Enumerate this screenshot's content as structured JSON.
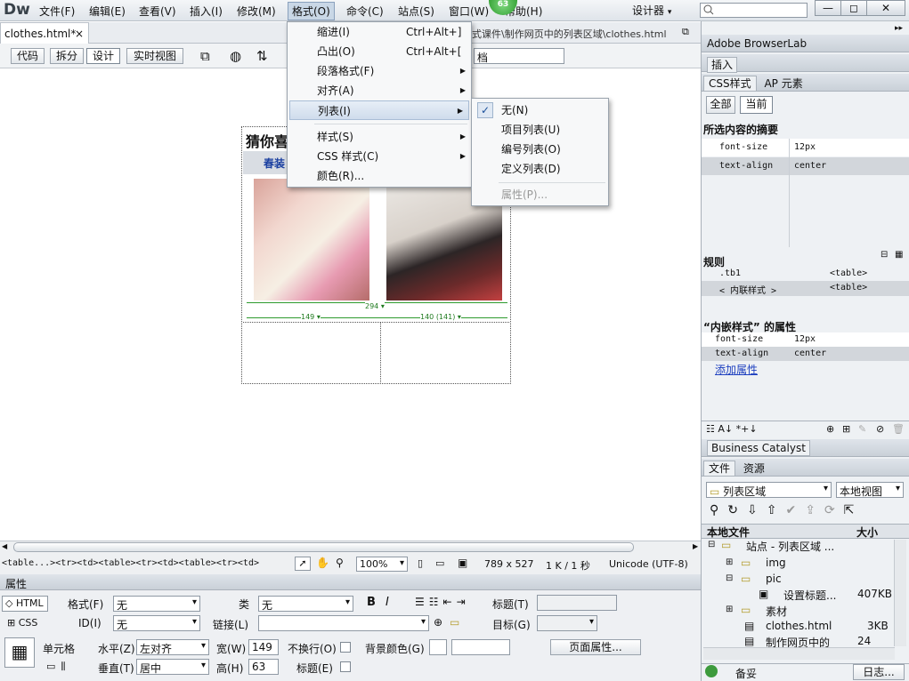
{
  "app": {
    "logo": "Dw",
    "workspace": "设计器"
  },
  "menubar": [
    "文件(F)",
    "编辑(E)",
    "查看(V)",
    "插入(I)",
    "修改(M)",
    "格式(O)",
    "命令(C)",
    "站点(S)",
    "窗口(W)",
    "帮助(H)"
  ],
  "badge": "63",
  "window_buttons": [
    "—",
    "◻",
    "✕"
  ],
  "doc": {
    "tab": "clothes.html*",
    "close": "×",
    "path": "式课件\\制作网页中的列表区域\\clothes.html"
  },
  "view_buttons": [
    "代码",
    "拆分",
    "设计",
    "实时视图"
  ],
  "title_partial": "档",
  "page": {
    "heading": "猜你喜",
    "link": "春装",
    "width_total": "294 ▾",
    "col1": "149 ▾",
    "col2": "140 (141) ▾"
  },
  "format_menu": [
    {
      "label": "缩进(I)",
      "shortcut": "Ctrl+Alt+]"
    },
    {
      "label": "凸出(O)",
      "shortcut": "Ctrl+Alt+["
    },
    {
      "label": "段落格式(F)"
    },
    {
      "label": "对齐(A)"
    },
    {
      "label": "列表(I)"
    },
    {
      "label": "样式(S)"
    },
    {
      "label": "CSS 样式(C)"
    },
    {
      "label": "颜色(R)..."
    }
  ],
  "list_submenu": [
    "无(N)",
    "项目列表(U)",
    "编号列表(O)",
    "定义列表(D)",
    "属性(P)..."
  ],
  "check": "✓",
  "right_panel": {
    "browserlab": "Adobe BrowserLab",
    "insert": "插入",
    "css_tab": "CSS样式",
    "ap_tab": "AP 元素",
    "all_btn": "全部",
    "current_btn": "当前",
    "summary_title": "所选内容的摘要",
    "summary": [
      [
        "font-size",
        "12px"
      ],
      [
        "text-align",
        "center"
      ]
    ],
    "rules_title": "规则",
    "rules": [
      [
        ".tb1",
        "<table>"
      ],
      [
        "< 内联样式 >",
        "<table>"
      ]
    ],
    "props_title": "“内嵌样式” 的属性",
    "props": [
      [
        "font-size",
        "12px"
      ],
      [
        "text-align",
        "center"
      ]
    ],
    "add_prop": "添加属性",
    "bc": "Business Catalyst",
    "files_tab": "文件",
    "assets_tab": "资源",
    "site_select": "列表区域",
    "view_select": "本地视图",
    "local_files": "本地文件",
    "size": "大小",
    "tree": [
      [
        "站点 - 列表区域 ...",
        ""
      ],
      [
        "img",
        ""
      ],
      [
        "pic",
        ""
      ],
      [
        "设置标题...",
        "407KB"
      ],
      [
        "素材",
        ""
      ],
      [
        "clothes.html",
        "3KB"
      ],
      [
        "制作网页中的",
        "24"
      ]
    ],
    "status": "备妥",
    "log": "日志..."
  },
  "status": {
    "tags": "<table...><tr><td><table><tr><td><table><tr><td>",
    "zoom": "100%",
    "size": "789 x 527",
    "speed": "1 K / 1 秒",
    "enc": "Unicode (UTF-8)"
  },
  "props_panel": {
    "title": "属性",
    "html": "HTML",
    "css": "CSS",
    "format_lbl": "格式(F)",
    "format_val": "无",
    "class_lbl": "类",
    "class_val": "无",
    "id_lbl": "ID(I)",
    "id_val": "无",
    "link_lbl": "链接(L)",
    "title_lbl": "标题(T)",
    "target_lbl": "目标(G)",
    "cell_lbl": "单元格",
    "horz_lbl": "水平(Z)",
    "horz_val": "左对齐",
    "vert_lbl": "垂直(T)",
    "vert_val": "居中",
    "w_lbl": "宽(W)",
    "w_val": "149",
    "h_lbl": "高(H)",
    "h_val": "63",
    "nowrap_lbl": "不换行(O)",
    "header_lbl": "标题(E)",
    "bg_lbl": "背景颜色(G)",
    "page_props": "页面属性..."
  }
}
